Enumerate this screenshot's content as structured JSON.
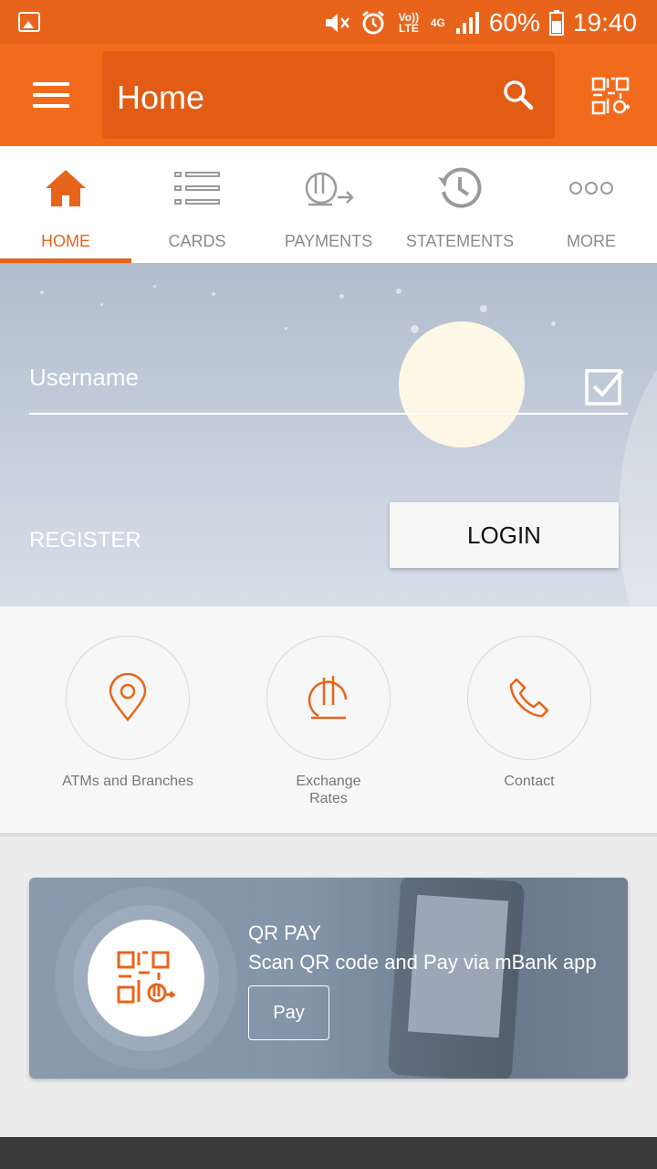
{
  "status_bar": {
    "battery": "60%",
    "time": "19:40",
    "network_volte": "Vo)) LTE",
    "network_type": "4G",
    "icons": [
      "image-icon",
      "mute-icon",
      "alarm-icon",
      "signal-icon",
      "battery-icon"
    ]
  },
  "app_bar": {
    "title": "Home",
    "icons": [
      "menu-icon",
      "search-icon",
      "qr-pay-icon"
    ]
  },
  "tabs": [
    {
      "label": "HOME",
      "icon": "home-icon",
      "active": true
    },
    {
      "label": "CARDS",
      "icon": "list-icon",
      "active": false
    },
    {
      "label": "PAYMENTS",
      "icon": "payment-transfer-icon",
      "active": false
    },
    {
      "label": "STATEMENTS",
      "icon": "history-icon",
      "active": false
    },
    {
      "label": "MORE",
      "icon": "more-dots-icon",
      "active": false
    }
  ],
  "login": {
    "username_placeholder": "Username",
    "register_label": "REGISTER",
    "login_label": "LOGIN"
  },
  "shortcuts": [
    {
      "label": "ATMs and Branches",
      "icon": "location-pin-icon"
    },
    {
      "label": "Exchange\nRates",
      "icon": "lari-currency-icon"
    },
    {
      "label": "Contact",
      "icon": "phone-icon"
    }
  ],
  "qr_pay": {
    "title": "QR PAY",
    "description": "Scan QR code and Pay via mBank app",
    "button_label": "Pay"
  },
  "colors": {
    "accent": "#f26b1d",
    "status_bar": "#e8641a",
    "search_box": "#e25c14",
    "inactive_tab": "#8a8a8a"
  }
}
